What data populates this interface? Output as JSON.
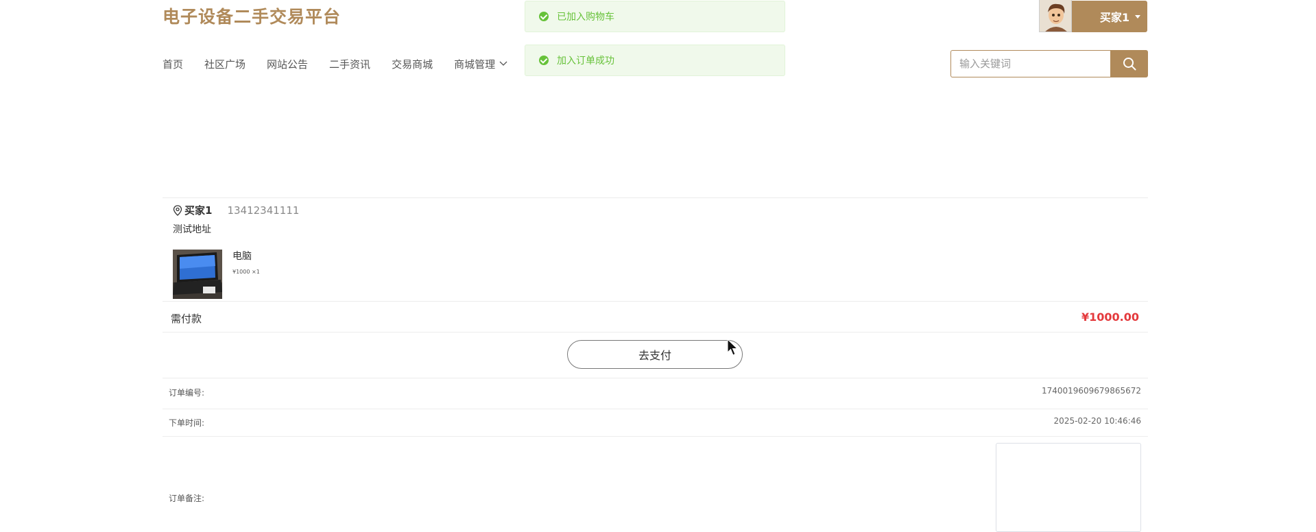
{
  "site": {
    "title": "电子设备二手交易平台"
  },
  "nav": {
    "items": [
      "首页",
      "社区广场",
      "网站公告",
      "二手资讯",
      "交易商城"
    ],
    "dropdown_label": "商城管理"
  },
  "toasts": [
    "已加入购物车",
    "加入订单成功"
  ],
  "user": {
    "name": "买家1"
  },
  "search": {
    "placeholder": "输入关键词"
  },
  "address": {
    "name": "买家1",
    "phone": "13412341111",
    "detail": "测试地址"
  },
  "product": {
    "name": "电脑",
    "price_line": "¥1000 ×1"
  },
  "payment": {
    "label": "需付款",
    "amount": "¥1000.00",
    "button_label": "去支付"
  },
  "order": {
    "number_label": "订单编号:",
    "number_value": "1740019609679865672",
    "time_label": "下单时间:",
    "time_value": "2025-02-20 10:46:46",
    "remark_label": "订单备注:"
  },
  "colors": {
    "brand": "#b08a5a",
    "success": "#67c23a",
    "price": "#e4393c"
  },
  "icons": {
    "toast": "check-circle-icon",
    "search": "search-icon",
    "address": "location-icon",
    "dropdown": "chevron-down-icon"
  }
}
